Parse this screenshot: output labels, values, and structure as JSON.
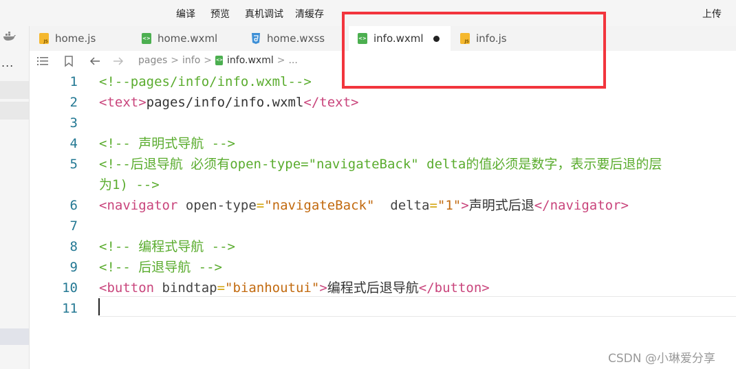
{
  "toolbar": {
    "compile": "编译",
    "preview": "预览",
    "debug": "真机调试",
    "clear_cache": "清缓存",
    "upload": "上传"
  },
  "left_strip": {
    "more": "..."
  },
  "tabs": [
    {
      "label": "home.js",
      "icon": "js-file-icon"
    },
    {
      "label": "home.wxml",
      "icon": "wxml-file-icon"
    },
    {
      "label": "home.wxss",
      "icon": "css-file-icon"
    },
    {
      "label": "info.wxml",
      "icon": "wxml-file-icon",
      "active": true,
      "unsaved": true
    },
    {
      "label": "info.js",
      "icon": "js-file-icon"
    }
  ],
  "breadcrumb": {
    "pages": "pages",
    "sep": ">",
    "info": "info",
    "file": "info.wxml",
    "more": "..."
  },
  "lines": {
    "n1": "1",
    "n2": "2",
    "n3": "3",
    "n4": "4",
    "n5": "5",
    "n6": "6",
    "n7": "7",
    "n8": "8",
    "n9": "9",
    "n10": "10",
    "n11": "11"
  },
  "code": {
    "l1": "<!--pages/info/info.wxml-->",
    "l2_open": "<text>",
    "l2_text": "pages/info/info.wxml",
    "l2_close": "</text>",
    "l4": "<!-- 声明式导航 -->",
    "l5a": "<!--后退导航 必须有open-type=\"navigateBack\" delta的值必须是数字，表示要后退的层",
    "l5b": "为1) -->",
    "l6_tag": "<navigator",
    "l6_attr1": " open-type",
    "l6_eq1": "=",
    "l6_val1": "\"navigateBack\"",
    "l6_attr2": "  delta",
    "l6_eq2": "=",
    "l6_val2": "\"1\"",
    "l6_gt": ">",
    "l6_text": "声明式后退",
    "l6_close": "</navigator>",
    "l8": "<!-- 编程式导航 -->",
    "l9": "<!-- 后退导航 -->",
    "l10_tag": "<button",
    "l10_attr": " bindtap",
    "l10_eq": "=",
    "l10_val": "\"bianhoutui\"",
    "l10_gt": ">",
    "l10_text": "编程式后退导航",
    "l10_close": "</button>"
  },
  "watermark": "CSDN @小琳爱分享",
  "colors": {
    "highlight_box": "#f2353d",
    "comment": "#5aac2e",
    "tag": "#c9457c",
    "string": "#c26a0f",
    "line_number": "#237893"
  }
}
